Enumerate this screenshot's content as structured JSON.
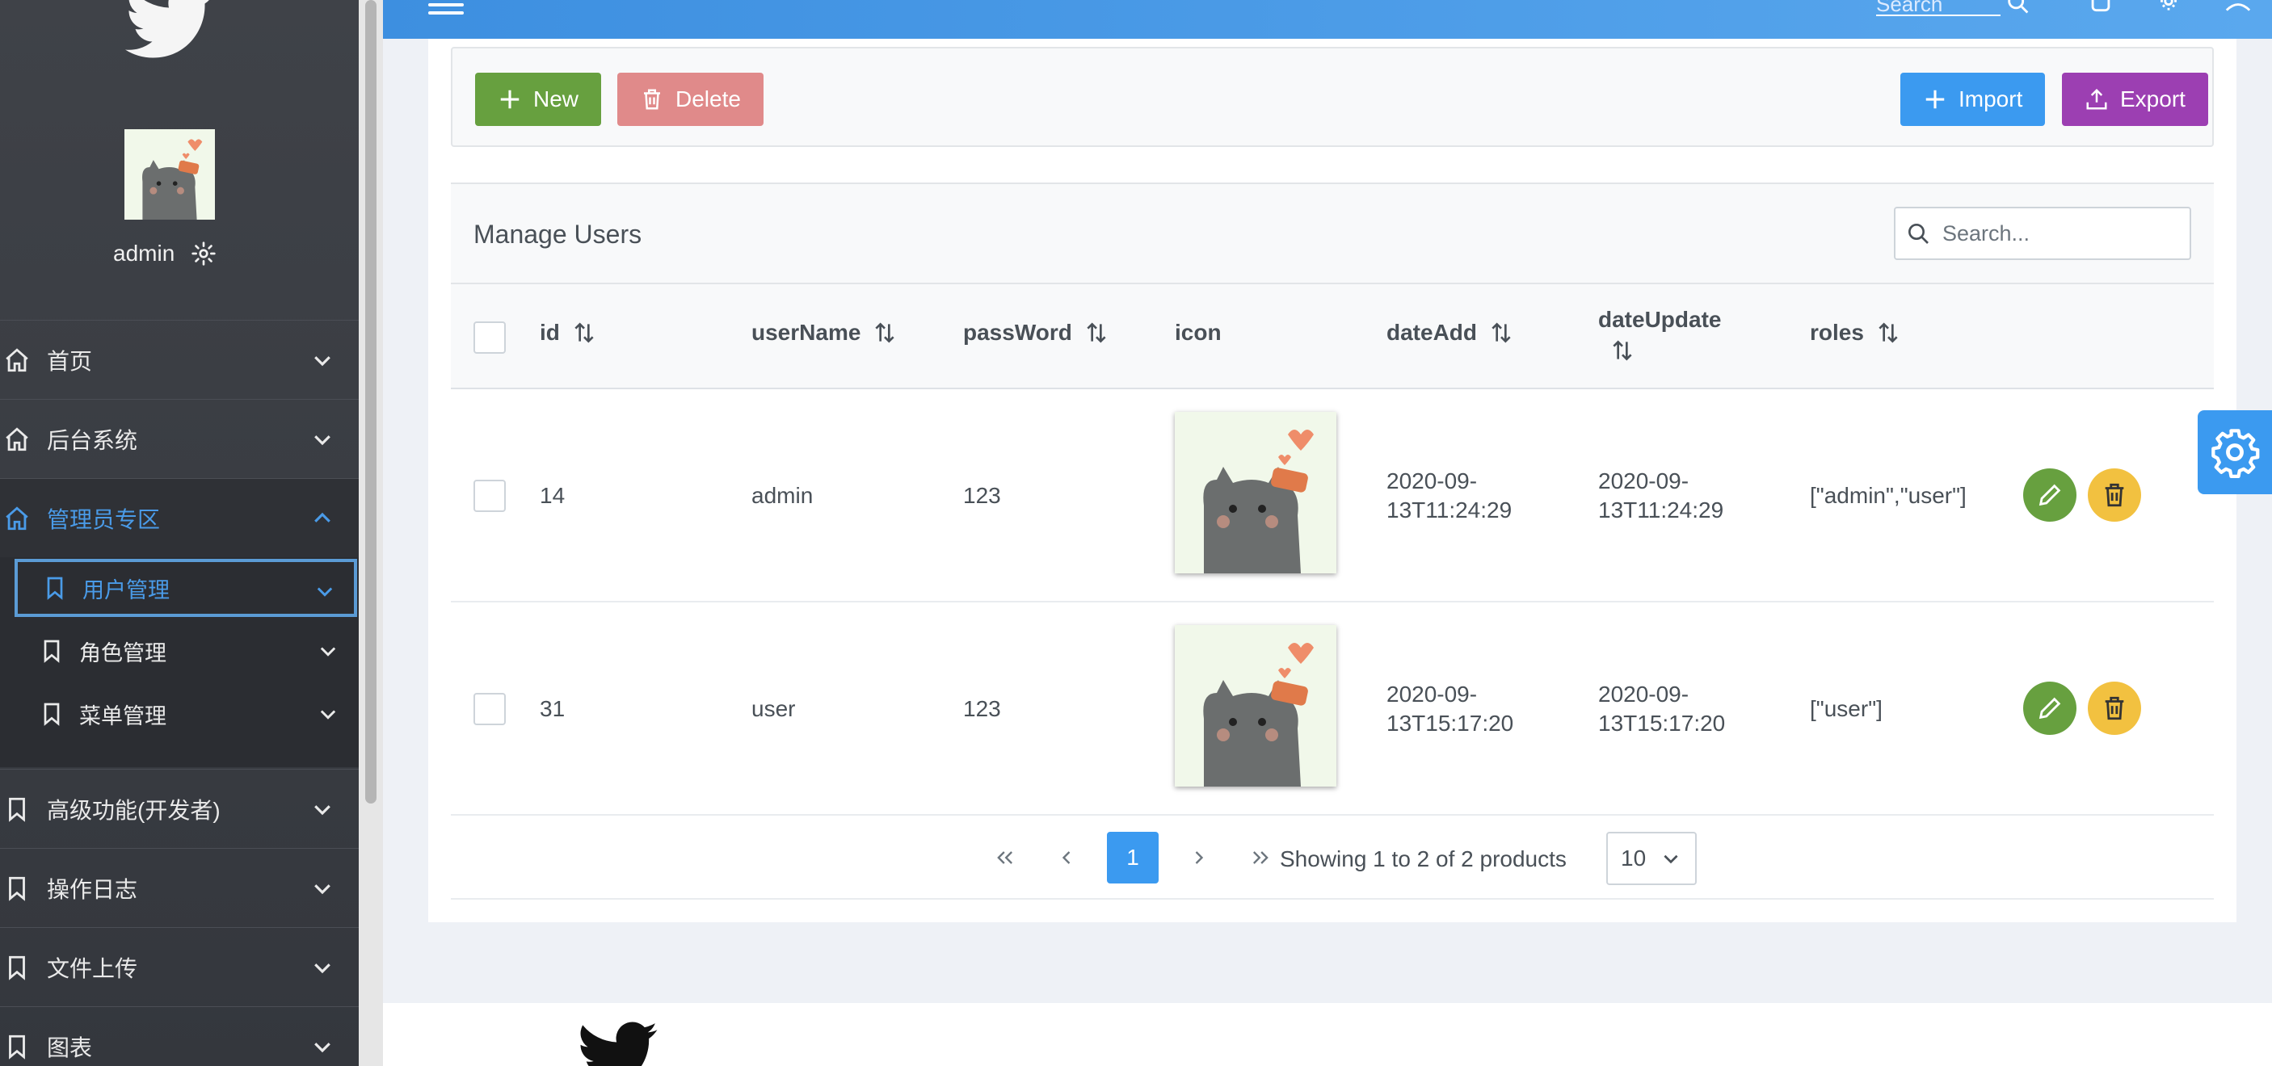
{
  "user": {
    "name": "admin"
  },
  "sidebar": {
    "items": [
      {
        "label": "首页"
      },
      {
        "label": "后台系统"
      },
      {
        "label": "管理员专区"
      },
      {
        "label": "高级功能(开发者)"
      },
      {
        "label": "操作日志"
      },
      {
        "label": "文件上传"
      },
      {
        "label": "图表"
      }
    ],
    "sub_items": [
      {
        "label": "用户管理"
      },
      {
        "label": "角色管理"
      },
      {
        "label": "菜单管理"
      }
    ]
  },
  "header": {
    "search_placeholder": "Search"
  },
  "toolbar": {
    "new_label": "New",
    "delete_label": "Delete",
    "import_label": "Import",
    "export_label": "Export"
  },
  "table": {
    "title": "Manage Users",
    "search_placeholder": "Search...",
    "columns": [
      "id",
      "userName",
      "passWord",
      "icon",
      "dateAdd",
      "dateUpdate",
      "roles"
    ],
    "rows": [
      {
        "id": "14",
        "userName": "admin",
        "passWord": "123",
        "dateAdd": "2020-09-13T11:24:29",
        "dateUpdate": "2020-09-13T11:24:29",
        "roles": "[\"admin\",\"user\"]"
      },
      {
        "id": "31",
        "userName": "user",
        "passWord": "123",
        "dateAdd": "2020-09-13T15:17:20",
        "dateUpdate": "2020-09-13T15:17:20",
        "roles": "[\"user\"]"
      }
    ]
  },
  "pagination": {
    "current_page": "1",
    "summary": "Showing 1 to 2 of 2 products",
    "page_size": "10"
  },
  "colors": {
    "primary": "#3b9af0",
    "success": "#67a03f",
    "danger": "#e08a8a",
    "purple": "#9c3fb2",
    "warning": "#f2c140"
  },
  "icons": [
    "twitter-bird-icon",
    "gear-icon",
    "home-icon",
    "bookmark-icon",
    "chevron-down-icon",
    "chevron-up-icon",
    "plus-icon",
    "trash-icon",
    "upload-icon",
    "search-icon",
    "sort-icon",
    "edit-icon",
    "menu-icon",
    "user-icon"
  ]
}
